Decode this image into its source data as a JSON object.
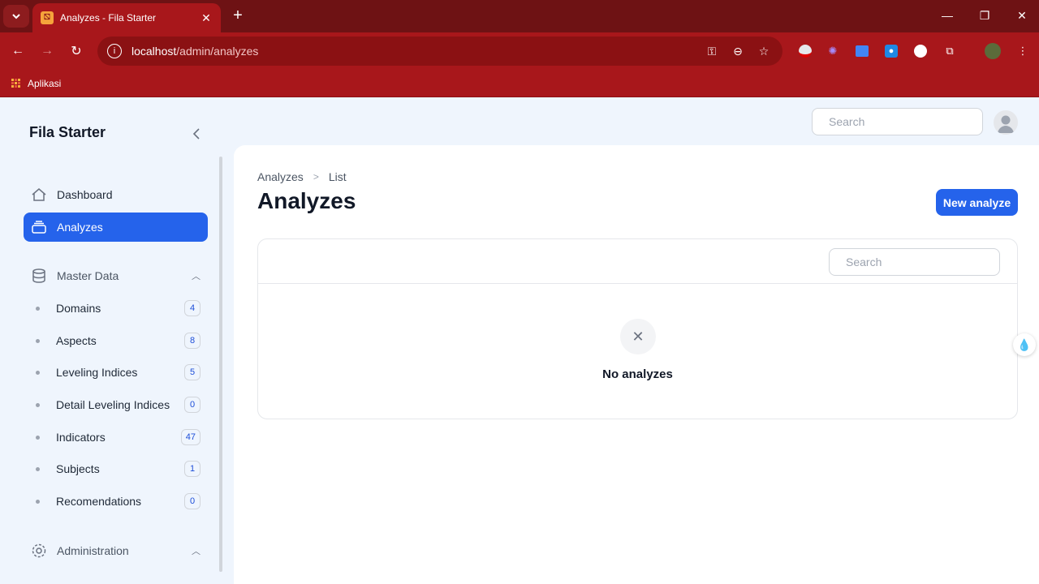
{
  "browser": {
    "tab_title": "Analyzes - Fila Starter",
    "url_host": "localhost",
    "url_path": "/admin/analyzes",
    "bookmark_label": "Aplikasi"
  },
  "app": {
    "brand": "Fila Starter",
    "top_search_placeholder": "Search"
  },
  "sidebar": {
    "items": [
      {
        "label": "Dashboard",
        "icon": "home-icon"
      },
      {
        "label": "Analyzes",
        "icon": "inbox-stack-icon",
        "active": true
      }
    ],
    "groups": [
      {
        "label": "Master Data",
        "icon": "database-icon"
      },
      {
        "label": "Administration",
        "icon": "gear-icon"
      }
    ],
    "master_data": [
      {
        "label": "Domains",
        "count": "4"
      },
      {
        "label": "Aspects",
        "count": "8"
      },
      {
        "label": "Leveling Indices",
        "count": "5"
      },
      {
        "label": "Detail Leveling Indices",
        "count": "0"
      },
      {
        "label": "Indicators",
        "count": "47"
      },
      {
        "label": "Subjects",
        "count": "1"
      },
      {
        "label": "Recomendations",
        "count": "0"
      }
    ]
  },
  "main": {
    "breadcrumb": [
      "Analyzes",
      "List"
    ],
    "title": "Analyzes",
    "new_button": "New analyze",
    "table_search_placeholder": "Search",
    "empty_text": "No analyzes"
  },
  "colors": {
    "primary": "#2563eb",
    "browser_frame": "#a8171b"
  }
}
